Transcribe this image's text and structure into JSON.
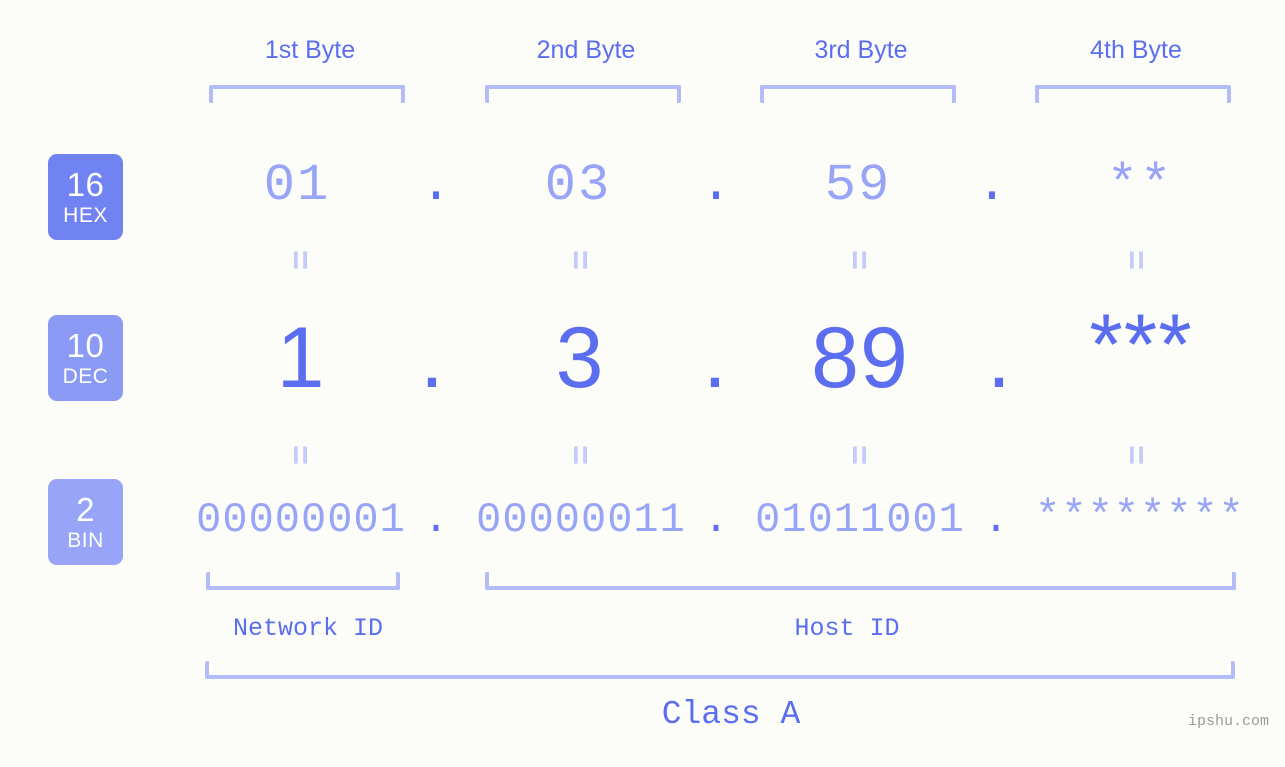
{
  "background_color": "#fcfdf8",
  "accent_color": "#5b6ef0",
  "accent_light_color": "#97a4f7",
  "bracket_color": "#b3bcf9",
  "headers": [
    {
      "label": "1st Byte"
    },
    {
      "label": "2nd Byte"
    },
    {
      "label": "3rd Byte"
    },
    {
      "label": "4th Byte"
    }
  ],
  "rows": [
    {
      "badge_number": "16",
      "badge_name": "HEX",
      "badge_color": "#7183f2",
      "values": [
        "01",
        "03",
        "59",
        "**"
      ],
      "separator": "."
    },
    {
      "badge_number": "10",
      "badge_name": "DEC",
      "badge_color": "#8b9af5",
      "values": [
        "1",
        "3",
        "89",
        "***"
      ],
      "separator": "."
    },
    {
      "badge_number": "2",
      "badge_name": "BIN",
      "badge_color": "#97a4f7",
      "values": [
        "00000001",
        "00000011",
        "01011001",
        "********"
      ],
      "separator": "."
    }
  ],
  "equals_symbol": "=",
  "segments": {
    "network_id": "Network ID",
    "host_id": "Host ID"
  },
  "class_label": "Class A",
  "watermark": "ipshu.com"
}
